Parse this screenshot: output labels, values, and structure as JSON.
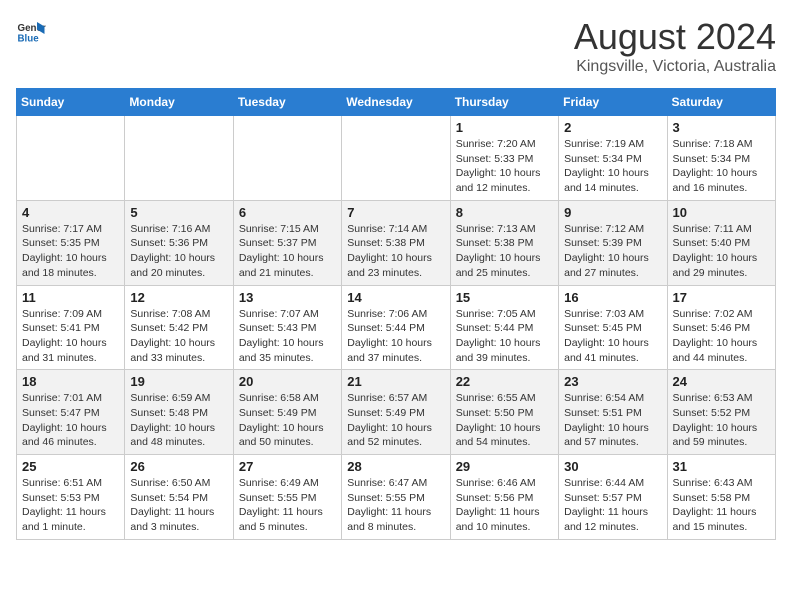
{
  "header": {
    "logo_line1": "General",
    "logo_line2": "Blue",
    "title": "August 2024",
    "subtitle": "Kingsville, Victoria, Australia"
  },
  "weekdays": [
    "Sunday",
    "Monday",
    "Tuesday",
    "Wednesday",
    "Thursday",
    "Friday",
    "Saturday"
  ],
  "weeks": [
    [
      {
        "day": "",
        "info": ""
      },
      {
        "day": "",
        "info": ""
      },
      {
        "day": "",
        "info": ""
      },
      {
        "day": "",
        "info": ""
      },
      {
        "day": "1",
        "info": "Sunrise: 7:20 AM\nSunset: 5:33 PM\nDaylight: 10 hours\nand 12 minutes."
      },
      {
        "day": "2",
        "info": "Sunrise: 7:19 AM\nSunset: 5:34 PM\nDaylight: 10 hours\nand 14 minutes."
      },
      {
        "day": "3",
        "info": "Sunrise: 7:18 AM\nSunset: 5:34 PM\nDaylight: 10 hours\nand 16 minutes."
      }
    ],
    [
      {
        "day": "4",
        "info": "Sunrise: 7:17 AM\nSunset: 5:35 PM\nDaylight: 10 hours\nand 18 minutes."
      },
      {
        "day": "5",
        "info": "Sunrise: 7:16 AM\nSunset: 5:36 PM\nDaylight: 10 hours\nand 20 minutes."
      },
      {
        "day": "6",
        "info": "Sunrise: 7:15 AM\nSunset: 5:37 PM\nDaylight: 10 hours\nand 21 minutes."
      },
      {
        "day": "7",
        "info": "Sunrise: 7:14 AM\nSunset: 5:38 PM\nDaylight: 10 hours\nand 23 minutes."
      },
      {
        "day": "8",
        "info": "Sunrise: 7:13 AM\nSunset: 5:38 PM\nDaylight: 10 hours\nand 25 minutes."
      },
      {
        "day": "9",
        "info": "Sunrise: 7:12 AM\nSunset: 5:39 PM\nDaylight: 10 hours\nand 27 minutes."
      },
      {
        "day": "10",
        "info": "Sunrise: 7:11 AM\nSunset: 5:40 PM\nDaylight: 10 hours\nand 29 minutes."
      }
    ],
    [
      {
        "day": "11",
        "info": "Sunrise: 7:09 AM\nSunset: 5:41 PM\nDaylight: 10 hours\nand 31 minutes."
      },
      {
        "day": "12",
        "info": "Sunrise: 7:08 AM\nSunset: 5:42 PM\nDaylight: 10 hours\nand 33 minutes."
      },
      {
        "day": "13",
        "info": "Sunrise: 7:07 AM\nSunset: 5:43 PM\nDaylight: 10 hours\nand 35 minutes."
      },
      {
        "day": "14",
        "info": "Sunrise: 7:06 AM\nSunset: 5:44 PM\nDaylight: 10 hours\nand 37 minutes."
      },
      {
        "day": "15",
        "info": "Sunrise: 7:05 AM\nSunset: 5:44 PM\nDaylight: 10 hours\nand 39 minutes."
      },
      {
        "day": "16",
        "info": "Sunrise: 7:03 AM\nSunset: 5:45 PM\nDaylight: 10 hours\nand 41 minutes."
      },
      {
        "day": "17",
        "info": "Sunrise: 7:02 AM\nSunset: 5:46 PM\nDaylight: 10 hours\nand 44 minutes."
      }
    ],
    [
      {
        "day": "18",
        "info": "Sunrise: 7:01 AM\nSunset: 5:47 PM\nDaylight: 10 hours\nand 46 minutes."
      },
      {
        "day": "19",
        "info": "Sunrise: 6:59 AM\nSunset: 5:48 PM\nDaylight: 10 hours\nand 48 minutes."
      },
      {
        "day": "20",
        "info": "Sunrise: 6:58 AM\nSunset: 5:49 PM\nDaylight: 10 hours\nand 50 minutes."
      },
      {
        "day": "21",
        "info": "Sunrise: 6:57 AM\nSunset: 5:49 PM\nDaylight: 10 hours\nand 52 minutes."
      },
      {
        "day": "22",
        "info": "Sunrise: 6:55 AM\nSunset: 5:50 PM\nDaylight: 10 hours\nand 54 minutes."
      },
      {
        "day": "23",
        "info": "Sunrise: 6:54 AM\nSunset: 5:51 PM\nDaylight: 10 hours\nand 57 minutes."
      },
      {
        "day": "24",
        "info": "Sunrise: 6:53 AM\nSunset: 5:52 PM\nDaylight: 10 hours\nand 59 minutes."
      }
    ],
    [
      {
        "day": "25",
        "info": "Sunrise: 6:51 AM\nSunset: 5:53 PM\nDaylight: 11 hours\nand 1 minute."
      },
      {
        "day": "26",
        "info": "Sunrise: 6:50 AM\nSunset: 5:54 PM\nDaylight: 11 hours\nand 3 minutes."
      },
      {
        "day": "27",
        "info": "Sunrise: 6:49 AM\nSunset: 5:55 PM\nDaylight: 11 hours\nand 5 minutes."
      },
      {
        "day": "28",
        "info": "Sunrise: 6:47 AM\nSunset: 5:55 PM\nDaylight: 11 hours\nand 8 minutes."
      },
      {
        "day": "29",
        "info": "Sunrise: 6:46 AM\nSunset: 5:56 PM\nDaylight: 11 hours\nand 10 minutes."
      },
      {
        "day": "30",
        "info": "Sunrise: 6:44 AM\nSunset: 5:57 PM\nDaylight: 11 hours\nand 12 minutes."
      },
      {
        "day": "31",
        "info": "Sunrise: 6:43 AM\nSunset: 5:58 PM\nDaylight: 11 hours\nand 15 minutes."
      }
    ]
  ]
}
